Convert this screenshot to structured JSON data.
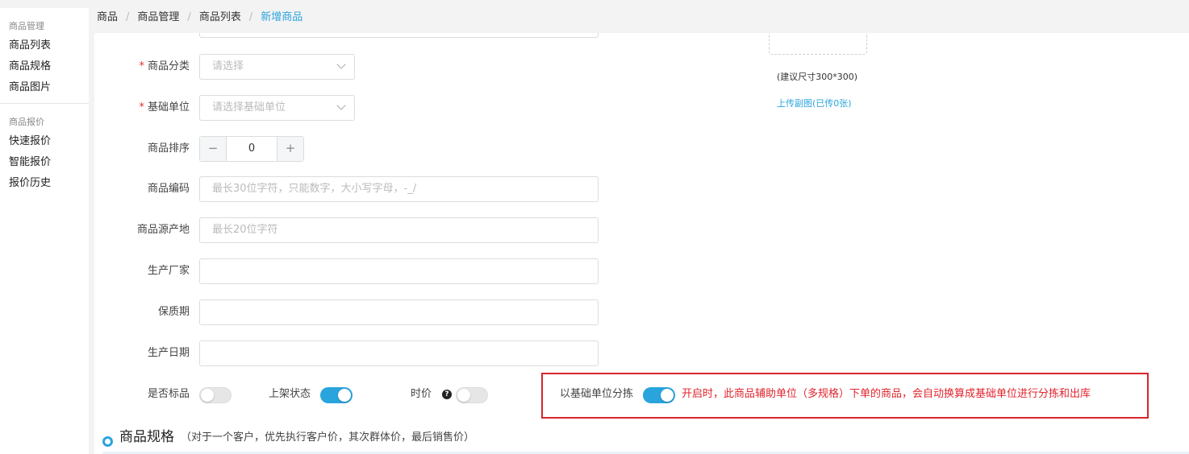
{
  "sidebar": {
    "groups": [
      {
        "title": "商品管理",
        "items": [
          "商品列表",
          "商品规格",
          "商品图片"
        ]
      },
      {
        "title": "商品报价",
        "items": [
          "快速报价",
          "智能报价",
          "报价历史"
        ]
      }
    ]
  },
  "breadcrumb": [
    "商品",
    "商品管理",
    "商品列表",
    "新增商品"
  ],
  "form": {
    "category": {
      "label": "商品分类",
      "placeholder": "请选择",
      "required": true
    },
    "base_unit": {
      "label": "基础单位",
      "placeholder": "请选择基础单位",
      "required": true
    },
    "sort": {
      "label": "商品排序",
      "value": "0",
      "minus": "−",
      "plus": "+"
    },
    "code": {
      "label": "商品编码",
      "placeholder": "最长30位字符，只能数字，大小写字母，-_/"
    },
    "origin": {
      "label": "商品源产地",
      "placeholder": "最长20位字符"
    },
    "manufacturer": {
      "label": "生产厂家",
      "placeholder": ""
    },
    "shelf_life": {
      "label": "保质期",
      "placeholder": ""
    },
    "production_date": {
      "label": "生产日期",
      "placeholder": ""
    },
    "required_mark": "*"
  },
  "toggles": {
    "standard": {
      "label": "是否标品",
      "on": false
    },
    "listing": {
      "label": "上架状态",
      "on": true
    },
    "market_price": {
      "label": "时价",
      "on": false,
      "help_icon": "question-circle-icon",
      "help_glyph": "?"
    },
    "base_unit_sorting": {
      "label": "以基础单位分拣",
      "on": true,
      "note": "开启时，此商品辅助单位（多规格）下单的商品，会自动换算成基础单位进行分拣和出库"
    }
  },
  "upload": {
    "hint": "(建议尺寸300*300)",
    "link": "上传副图(已传0张)"
  },
  "section": {
    "title": "商品规格",
    "subtitle": "（对于一个客户，优先执行客户价，其次群体价，最后销售价）"
  },
  "colors": {
    "accent": "#2aa4dc",
    "required": "#e03030",
    "highlight_border": "#d8242d",
    "note_text": "#e0242d"
  }
}
